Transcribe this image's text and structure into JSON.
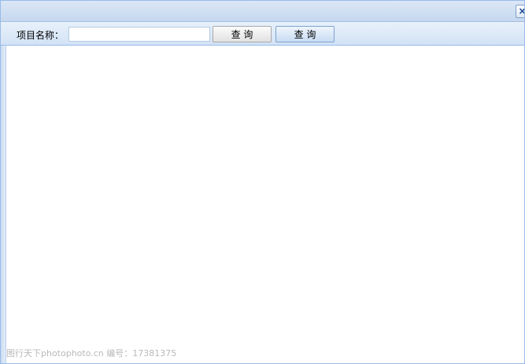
{
  "window": {
    "close_glyph": "×"
  },
  "toolbar": {
    "field_label": "项目名称：",
    "search_value": "",
    "buttons": [
      {
        "label": "查 询"
      },
      {
        "label": "查 询"
      }
    ]
  },
  "watermark": {
    "text": "图行天下photophoto.cn 编号：17381375"
  },
  "colors": {
    "title_bar": "#c6d8ef",
    "toolbar": "#d2e2f5",
    "border": "#99bbe8"
  }
}
